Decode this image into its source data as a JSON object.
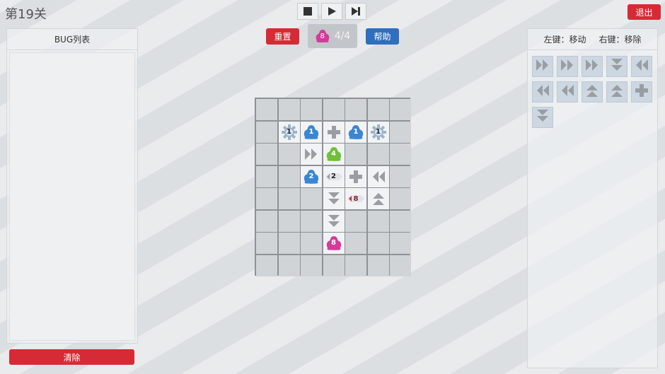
{
  "level": {
    "title": "第19关"
  },
  "transport": {
    "buttons": [
      "stop-icon",
      "play-icon",
      "step-icon"
    ]
  },
  "exit": {
    "label": "退出"
  },
  "bug_list": {
    "title": "BUG列表",
    "clear_label": "清除"
  },
  "controls": {
    "reset_label": "重置",
    "help_label": "帮助",
    "counter_badge": "8",
    "counter_text": "4/4"
  },
  "colors": {
    "red": "#d62b36",
    "blue": "#2f6fbf",
    "bug_blue": "#3a86d4",
    "bug_green": "#6fbf3a",
    "bug_pink": "#d63a9a",
    "arrow": "#9a9ea3"
  },
  "board": {
    "cols": 7,
    "rows": 8,
    "open_cells": [
      [
        1,
        1
      ],
      [
        1,
        2
      ],
      [
        1,
        3
      ],
      [
        1,
        4
      ],
      [
        1,
        5
      ],
      [
        2,
        2
      ],
      [
        2,
        3
      ],
      [
        3,
        2
      ],
      [
        3,
        3
      ],
      [
        3,
        4
      ],
      [
        3,
        5
      ],
      [
        4,
        3
      ],
      [
        4,
        4
      ],
      [
        4,
        5
      ],
      [
        5,
        3
      ],
      [
        6,
        3
      ]
    ],
    "pieces": [
      {
        "type": "gear-bug",
        "label": "1",
        "row": 1,
        "col": 1
      },
      {
        "type": "bug",
        "color": "blue",
        "label": "1",
        "row": 1,
        "col": 2
      },
      {
        "type": "plus",
        "row": 1,
        "col": 3
      },
      {
        "type": "bug",
        "color": "blue",
        "label": "1",
        "row": 1,
        "col": 4
      },
      {
        "type": "gear-bug",
        "label": "1",
        "row": 1,
        "col": 5
      },
      {
        "type": "arrow-right",
        "row": 2,
        "col": 2
      },
      {
        "type": "bug",
        "color": "green",
        "label": "4",
        "row": 2,
        "col": 3
      },
      {
        "type": "bug",
        "color": "blue",
        "label": "2",
        "row": 3,
        "col": 2
      },
      {
        "type": "diamond",
        "label": "2",
        "row": 3,
        "col": 3
      },
      {
        "type": "plus",
        "row": 3,
        "col": 4
      },
      {
        "type": "arrow-left",
        "row": 3,
        "col": 5
      },
      {
        "type": "arrow-down",
        "row": 4,
        "col": 3
      },
      {
        "type": "diamond-red",
        "label": "8",
        "row": 4,
        "col": 4
      },
      {
        "type": "arrow-up",
        "row": 4,
        "col": 5
      },
      {
        "type": "arrow-down",
        "row": 5,
        "col": 3
      },
      {
        "type": "bug",
        "color": "pink",
        "label": "8",
        "row": 6,
        "col": 3
      }
    ]
  },
  "tool_panel": {
    "left_hint": "左键：移动",
    "right_hint": "右键：移除",
    "tools": [
      "arrow-right",
      "arrow-right",
      "arrow-right",
      "arrow-down",
      "arrow-left",
      "arrow-left",
      "arrow-left",
      "arrow-up",
      "arrow-up",
      "plus",
      "arrow-down"
    ]
  }
}
